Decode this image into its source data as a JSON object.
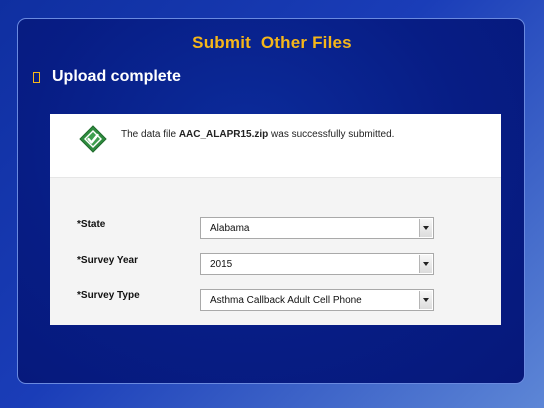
{
  "slide": {
    "title": "Submit  Other Files",
    "bullet": "Upload complete"
  },
  "message": {
    "prefix": "The data file ",
    "filename": "AAC_ALAPR15.zip",
    "suffix": " was successfully submitted.",
    "icon": "success-check-icon"
  },
  "form": {
    "required_marker": "*",
    "fields": [
      {
        "label": "State",
        "value": "Alabama"
      },
      {
        "label": "Survey Year",
        "value": "2015"
      },
      {
        "label": "Survey Type",
        "value": "Asthma Callback Adult Cell Phone"
      }
    ]
  },
  "colors": {
    "title": "#f5b61a",
    "background": "#071d85",
    "success": "#2e8b3e"
  }
}
